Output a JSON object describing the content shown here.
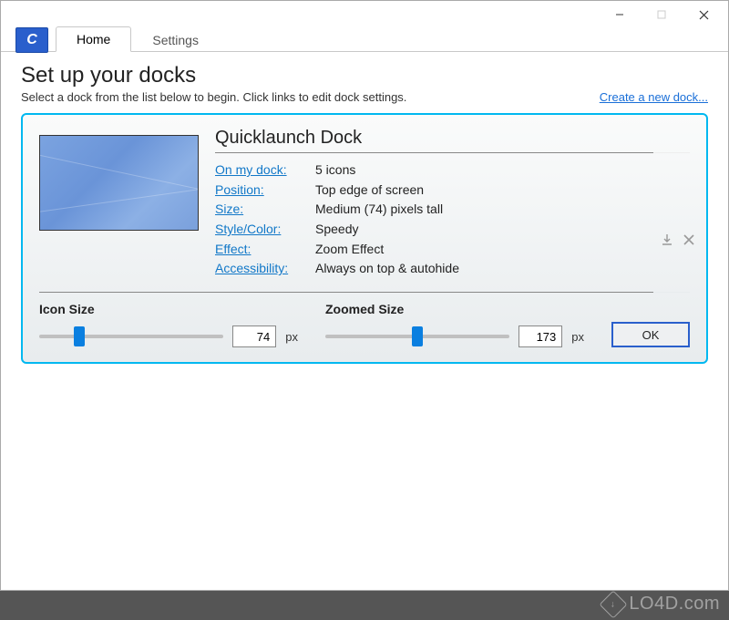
{
  "tabs": {
    "home": "Home",
    "settings": "Settings"
  },
  "heading": {
    "title": "Set up your docks",
    "subtitle": "Select a dock from the list below to begin. Click links to edit dock settings.",
    "create_link": "Create a new dock..."
  },
  "dock": {
    "name": "Quicklaunch Dock",
    "props": {
      "on_my_dock_label": "On my dock:",
      "on_my_dock_value": "5 icons",
      "position_label": "Position:",
      "position_value": "Top edge of screen",
      "size_label": "Size:",
      "size_value": "Medium (74) pixels tall",
      "style_label": "Style/Color:",
      "style_value": "Speedy",
      "effect_label": "Effect:",
      "effect_value": "Zoom Effect",
      "access_label": "Accessibility:",
      "access_value": "Always on top & autohide"
    }
  },
  "sliders": {
    "icon_size_label": "Icon Size",
    "icon_size_value": "74",
    "icon_size_pct": 22,
    "zoomed_size_label": "Zoomed Size",
    "zoomed_size_value": "173",
    "zoomed_size_pct": 50,
    "unit": "px"
  },
  "buttons": {
    "ok": "OK"
  },
  "watermark": "LO4D.com"
}
